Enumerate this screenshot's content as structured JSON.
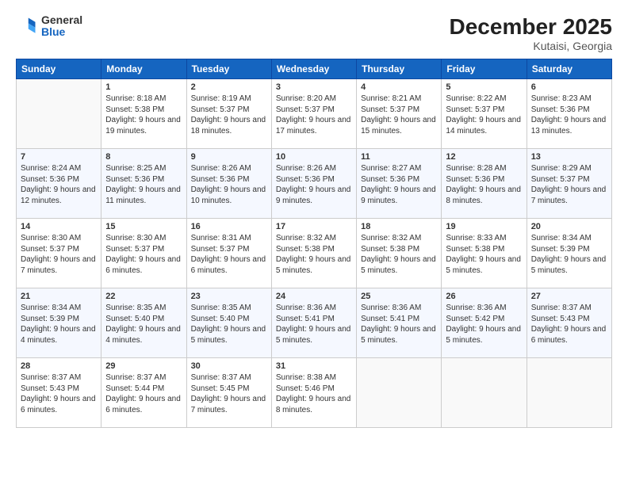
{
  "header": {
    "logo": {
      "general": "General",
      "blue": "Blue"
    },
    "title": "December 2025",
    "subtitle": "Kutaisi, Georgia"
  },
  "calendar": {
    "days_of_week": [
      "Sunday",
      "Monday",
      "Tuesday",
      "Wednesday",
      "Thursday",
      "Friday",
      "Saturday"
    ],
    "weeks": [
      [
        {
          "day": "",
          "sunrise": "",
          "sunset": "",
          "daylight": ""
        },
        {
          "day": "1",
          "sunrise": "Sunrise: 8:18 AM",
          "sunset": "Sunset: 5:38 PM",
          "daylight": "Daylight: 9 hours and 19 minutes."
        },
        {
          "day": "2",
          "sunrise": "Sunrise: 8:19 AM",
          "sunset": "Sunset: 5:37 PM",
          "daylight": "Daylight: 9 hours and 18 minutes."
        },
        {
          "day": "3",
          "sunrise": "Sunrise: 8:20 AM",
          "sunset": "Sunset: 5:37 PM",
          "daylight": "Daylight: 9 hours and 17 minutes."
        },
        {
          "day": "4",
          "sunrise": "Sunrise: 8:21 AM",
          "sunset": "Sunset: 5:37 PM",
          "daylight": "Daylight: 9 hours and 15 minutes."
        },
        {
          "day": "5",
          "sunrise": "Sunrise: 8:22 AM",
          "sunset": "Sunset: 5:37 PM",
          "daylight": "Daylight: 9 hours and 14 minutes."
        },
        {
          "day": "6",
          "sunrise": "Sunrise: 8:23 AM",
          "sunset": "Sunset: 5:36 PM",
          "daylight": "Daylight: 9 hours and 13 minutes."
        }
      ],
      [
        {
          "day": "7",
          "sunrise": "Sunrise: 8:24 AM",
          "sunset": "Sunset: 5:36 PM",
          "daylight": "Daylight: 9 hours and 12 minutes."
        },
        {
          "day": "8",
          "sunrise": "Sunrise: 8:25 AM",
          "sunset": "Sunset: 5:36 PM",
          "daylight": "Daylight: 9 hours and 11 minutes."
        },
        {
          "day": "9",
          "sunrise": "Sunrise: 8:26 AM",
          "sunset": "Sunset: 5:36 PM",
          "daylight": "Daylight: 9 hours and 10 minutes."
        },
        {
          "day": "10",
          "sunrise": "Sunrise: 8:26 AM",
          "sunset": "Sunset: 5:36 PM",
          "daylight": "Daylight: 9 hours and 9 minutes."
        },
        {
          "day": "11",
          "sunrise": "Sunrise: 8:27 AM",
          "sunset": "Sunset: 5:36 PM",
          "daylight": "Daylight: 9 hours and 9 minutes."
        },
        {
          "day": "12",
          "sunrise": "Sunrise: 8:28 AM",
          "sunset": "Sunset: 5:36 PM",
          "daylight": "Daylight: 9 hours and 8 minutes."
        },
        {
          "day": "13",
          "sunrise": "Sunrise: 8:29 AM",
          "sunset": "Sunset: 5:37 PM",
          "daylight": "Daylight: 9 hours and 7 minutes."
        }
      ],
      [
        {
          "day": "14",
          "sunrise": "Sunrise: 8:30 AM",
          "sunset": "Sunset: 5:37 PM",
          "daylight": "Daylight: 9 hours and 7 minutes."
        },
        {
          "day": "15",
          "sunrise": "Sunrise: 8:30 AM",
          "sunset": "Sunset: 5:37 PM",
          "daylight": "Daylight: 9 hours and 6 minutes."
        },
        {
          "day": "16",
          "sunrise": "Sunrise: 8:31 AM",
          "sunset": "Sunset: 5:37 PM",
          "daylight": "Daylight: 9 hours and 6 minutes."
        },
        {
          "day": "17",
          "sunrise": "Sunrise: 8:32 AM",
          "sunset": "Sunset: 5:38 PM",
          "daylight": "Daylight: 9 hours and 5 minutes."
        },
        {
          "day": "18",
          "sunrise": "Sunrise: 8:32 AM",
          "sunset": "Sunset: 5:38 PM",
          "daylight": "Daylight: 9 hours and 5 minutes."
        },
        {
          "day": "19",
          "sunrise": "Sunrise: 8:33 AM",
          "sunset": "Sunset: 5:38 PM",
          "daylight": "Daylight: 9 hours and 5 minutes."
        },
        {
          "day": "20",
          "sunrise": "Sunrise: 8:34 AM",
          "sunset": "Sunset: 5:39 PM",
          "daylight": "Daylight: 9 hours and 5 minutes."
        }
      ],
      [
        {
          "day": "21",
          "sunrise": "Sunrise: 8:34 AM",
          "sunset": "Sunset: 5:39 PM",
          "daylight": "Daylight: 9 hours and 4 minutes."
        },
        {
          "day": "22",
          "sunrise": "Sunrise: 8:35 AM",
          "sunset": "Sunset: 5:40 PM",
          "daylight": "Daylight: 9 hours and 4 minutes."
        },
        {
          "day": "23",
          "sunrise": "Sunrise: 8:35 AM",
          "sunset": "Sunset: 5:40 PM",
          "daylight": "Daylight: 9 hours and 5 minutes."
        },
        {
          "day": "24",
          "sunrise": "Sunrise: 8:36 AM",
          "sunset": "Sunset: 5:41 PM",
          "daylight": "Daylight: 9 hours and 5 minutes."
        },
        {
          "day": "25",
          "sunrise": "Sunrise: 8:36 AM",
          "sunset": "Sunset: 5:41 PM",
          "daylight": "Daylight: 9 hours and 5 minutes."
        },
        {
          "day": "26",
          "sunrise": "Sunrise: 8:36 AM",
          "sunset": "Sunset: 5:42 PM",
          "daylight": "Daylight: 9 hours and 5 minutes."
        },
        {
          "day": "27",
          "sunrise": "Sunrise: 8:37 AM",
          "sunset": "Sunset: 5:43 PM",
          "daylight": "Daylight: 9 hours and 6 minutes."
        }
      ],
      [
        {
          "day": "28",
          "sunrise": "Sunrise: 8:37 AM",
          "sunset": "Sunset: 5:43 PM",
          "daylight": "Daylight: 9 hours and 6 minutes."
        },
        {
          "day": "29",
          "sunrise": "Sunrise: 8:37 AM",
          "sunset": "Sunset: 5:44 PM",
          "daylight": "Daylight: 9 hours and 6 minutes."
        },
        {
          "day": "30",
          "sunrise": "Sunrise: 8:37 AM",
          "sunset": "Sunset: 5:45 PM",
          "daylight": "Daylight: 9 hours and 7 minutes."
        },
        {
          "day": "31",
          "sunrise": "Sunrise: 8:38 AM",
          "sunset": "Sunset: 5:46 PM",
          "daylight": "Daylight: 9 hours and 8 minutes."
        },
        {
          "day": "",
          "sunrise": "",
          "sunset": "",
          "daylight": ""
        },
        {
          "day": "",
          "sunrise": "",
          "sunset": "",
          "daylight": ""
        },
        {
          "day": "",
          "sunrise": "",
          "sunset": "",
          "daylight": ""
        }
      ]
    ]
  }
}
